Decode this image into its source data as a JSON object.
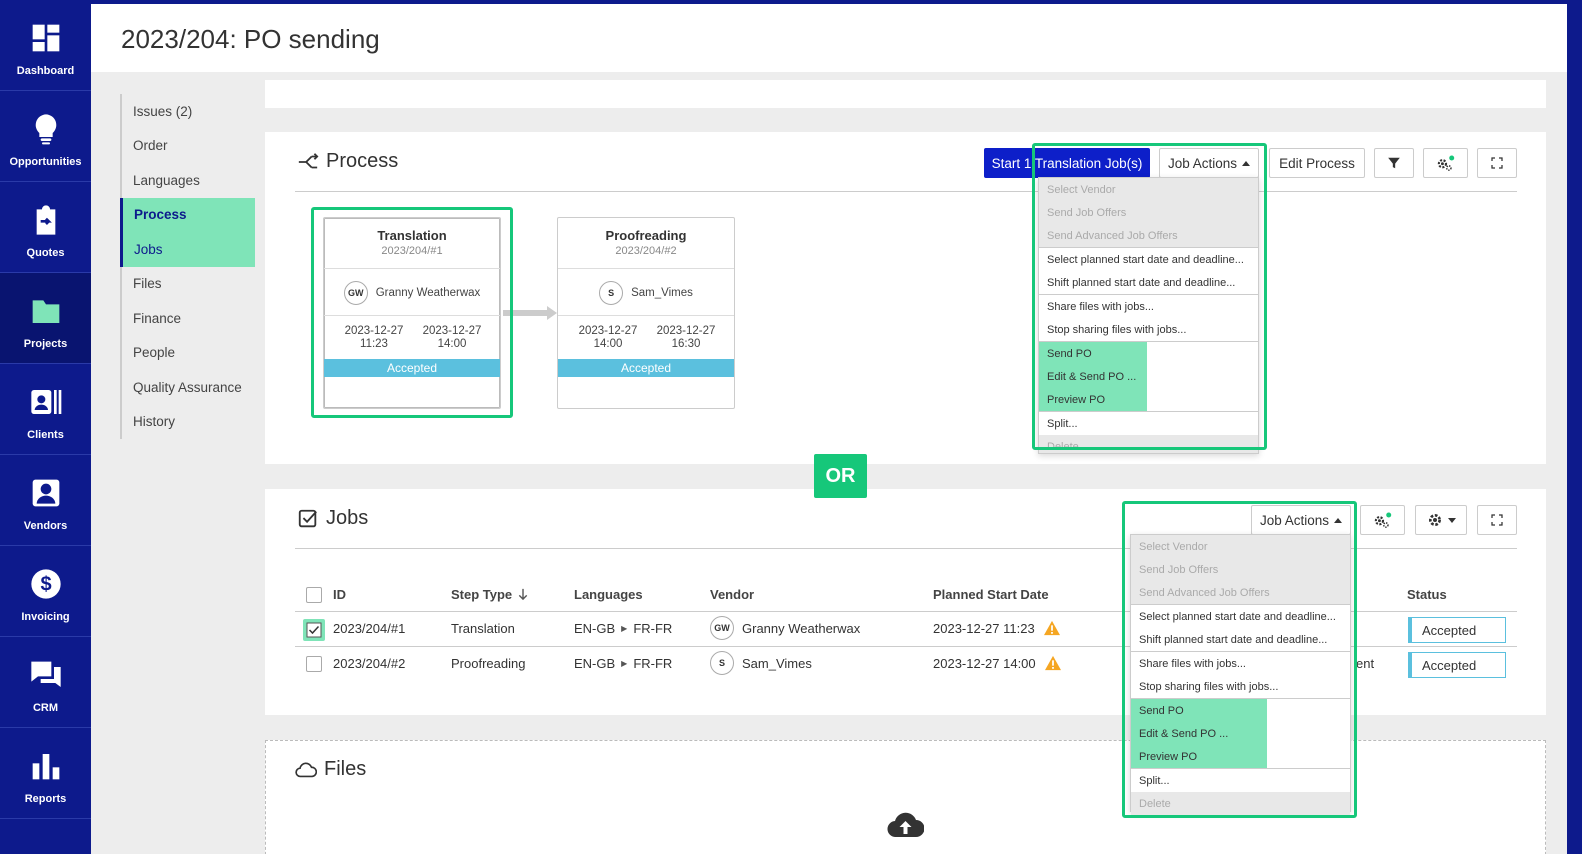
{
  "sidebar": {
    "items": [
      {
        "label": "Dashboard",
        "icon": "dashboard-icon"
      },
      {
        "label": "Opportunities",
        "icon": "lightbulb-icon"
      },
      {
        "label": "Quotes",
        "icon": "clipboard-icon"
      },
      {
        "label": "Projects",
        "icon": "folder-icon"
      },
      {
        "label": "Clients",
        "icon": "contact-card-icon"
      },
      {
        "label": "Vendors",
        "icon": "person-icon"
      },
      {
        "label": "Invoicing",
        "icon": "dollar-icon"
      },
      {
        "label": "CRM",
        "icon": "chat-icon"
      },
      {
        "label": "Reports",
        "icon": "bar-chart-icon"
      }
    ]
  },
  "header": {
    "title": "2023/204:  PO sending"
  },
  "secnav": {
    "items": [
      "Issues (2)",
      "Order",
      "Languages",
      "Process",
      "Jobs",
      "Files",
      "Finance",
      "People",
      "Quality Assurance",
      "History"
    ]
  },
  "process": {
    "title": "Process",
    "start_button": "Start 1 Translation Job(s)",
    "job_actions": "Job Actions",
    "edit_process": "Edit Process",
    "steps": [
      {
        "name": "Translation",
        "id": "2023/204/#1",
        "vendor_initials": "GW",
        "vendor": "Granny Weatherwax",
        "start_date": "2023-12-27",
        "start_time": "11:23",
        "end_date": "2023-12-27",
        "end_time": "14:00",
        "status": "Accepted"
      },
      {
        "name": "Proofreading",
        "id": "2023/204/#2",
        "vendor_initials": "S",
        "vendor": "Sam_Vimes",
        "start_date": "2023-12-27",
        "start_time": "14:00",
        "end_date": "2023-12-27",
        "end_time": "16:30",
        "status": "Accepted"
      }
    ]
  },
  "menu": {
    "items": [
      {
        "label": "Select Vendor",
        "state": "disabled"
      },
      {
        "label": "Send Job Offers",
        "state": "disabled"
      },
      {
        "label": "Send Advanced Job Offers",
        "state": "disabled"
      },
      {
        "label": "Select planned start date and deadline...",
        "state": "normal"
      },
      {
        "label": "Shift planned start date and deadline...",
        "state": "normal"
      },
      {
        "label": "Share files with jobs...",
        "state": "normal"
      },
      {
        "label": "Stop sharing files with jobs...",
        "state": "normal"
      },
      {
        "label": "Send PO",
        "state": "highlight"
      },
      {
        "label": "Edit & Send PO ...",
        "state": "highlight"
      },
      {
        "label": "Preview PO",
        "state": "highlight"
      },
      {
        "label": "Split...",
        "state": "normal"
      },
      {
        "label": "Delete",
        "state": "disabled"
      }
    ]
  },
  "or_label": "OR",
  "jobs": {
    "title": "Jobs",
    "job_actions": "Job Actions",
    "columns": {
      "id": "ID",
      "step_type": "Step Type",
      "languages": "Languages",
      "vendor": "Vendor",
      "planned_start": "Planned Start Date",
      "status": "Status"
    },
    "rows": [
      {
        "id": "2023/204/#1",
        "step_type": "Translation",
        "src": "EN-GB",
        "tgt": "FR-FR",
        "vendor_initials": "GW",
        "vendor": "Granny Weatherwax",
        "planned_start": "2023-12-27 11:23",
        "hidden_col": "",
        "status": "Accepted",
        "checked": true
      },
      {
        "id": "2023/204/#2",
        "step_type": "Proofreading",
        "src": "EN-GB",
        "tgt": "FR-FR",
        "vendor_initials": "S",
        "vendor": "Sam_Vimes",
        "planned_start": "2023-12-27 14:00",
        "hidden_col": "ent",
        "status": "Accepted",
        "checked": false
      }
    ]
  },
  "files": {
    "title": "Files"
  },
  "colors": {
    "brand": "#0d1a8c",
    "highlight": "#16c77a",
    "highlight_fill": "#7fe4b8",
    "status": "#5bc0de"
  }
}
